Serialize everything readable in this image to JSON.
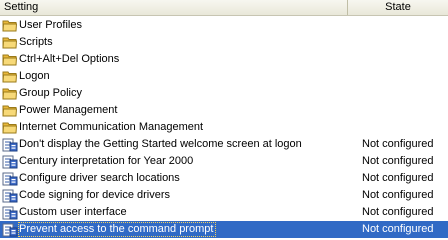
{
  "columns": {
    "setting": "Setting",
    "state": "State"
  },
  "colors": {
    "selection": "#316ac5",
    "folder": "#f5d26a",
    "header_bg": "#ebeadb"
  },
  "rows": [
    {
      "label": "User Profiles",
      "icon": "folder-icon",
      "state": ""
    },
    {
      "label": "Scripts",
      "icon": "folder-icon",
      "state": ""
    },
    {
      "label": "Ctrl+Alt+Del Options",
      "icon": "folder-icon",
      "state": ""
    },
    {
      "label": "Logon",
      "icon": "folder-icon",
      "state": ""
    },
    {
      "label": "Group Policy",
      "icon": "folder-icon",
      "state": ""
    },
    {
      "label": "Power Management",
      "icon": "folder-icon",
      "state": ""
    },
    {
      "label": "Internet Communication Management",
      "icon": "folder-icon",
      "state": ""
    },
    {
      "label": "Don't display the Getting Started welcome screen at logon",
      "icon": "policy-setting-icon",
      "state": "Not configured"
    },
    {
      "label": "Century interpretation for Year 2000",
      "icon": "policy-setting-icon",
      "state": "Not configured"
    },
    {
      "label": "Configure driver search locations",
      "icon": "policy-setting-icon",
      "state": "Not configured"
    },
    {
      "label": "Code signing for device drivers",
      "icon": "policy-setting-icon",
      "state": "Not configured"
    },
    {
      "label": "Custom user interface",
      "icon": "policy-setting-icon",
      "state": "Not configured"
    },
    {
      "label": "Prevent access to the command prompt",
      "icon": "policy-setting-icon",
      "state": "Not configured",
      "selected": true
    }
  ]
}
